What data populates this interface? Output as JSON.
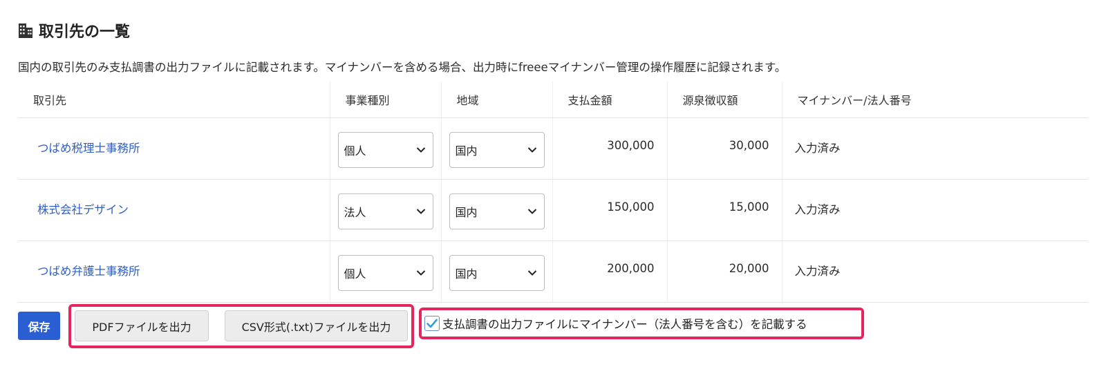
{
  "section": {
    "title": "取引先の一覧",
    "description": "国内の取引先のみ支払調書の出力ファイルに記載されます。マイナンバーを含める場合、出力時にfreeeマイナンバー管理の操作履歴に記録されます。"
  },
  "table": {
    "headers": [
      "取引先",
      "事業種別",
      "地域",
      "支払金額",
      "源泉徴収額",
      "マイナンバー/法人番号"
    ],
    "rows": [
      {
        "name": "つばめ税理士事務所",
        "type": "個人",
        "region": "国内",
        "payment": "300,000",
        "withholding": "30,000",
        "status": "入力済み"
      },
      {
        "name": "株式会社デザイン",
        "type": "法人",
        "region": "国内",
        "payment": "150,000",
        "withholding": "15,000",
        "status": "入力済み"
      },
      {
        "name": "つばめ弁護士事務所",
        "type": "個人",
        "region": "国内",
        "payment": "200,000",
        "withholding": "20,000",
        "status": "入力済み"
      }
    ]
  },
  "actions": {
    "save_label": "保存",
    "pdf_label": "PDFファイルを出力",
    "csv_label": "CSV形式(.txt)ファイルを出力",
    "include_mynumber_label": "支払調書の出力ファイルにマイナンバー（法人番号を含む）を記載する",
    "include_mynumber_checked": true
  },
  "icons": {
    "title_icon": "building-icon",
    "select_icon": "chevron-down-icon",
    "checkbox_icon": "check-icon"
  },
  "colors": {
    "link": "#2f5fc4",
    "primary": "#2a5fd3",
    "highlight": "#e6245e"
  }
}
